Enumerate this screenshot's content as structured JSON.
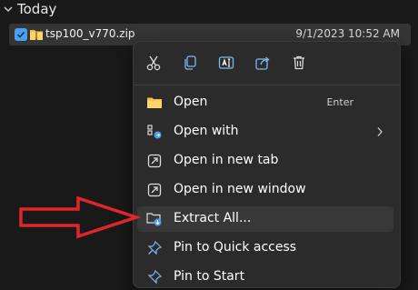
{
  "group": {
    "label": "Today",
    "icon": "chevron-down-icon"
  },
  "file": {
    "name": "tsp100_v770.zip",
    "date": "9/1/2023 10:52 AM",
    "checked": true,
    "icon": "zip-folder-icon"
  },
  "context_menu": {
    "toolbar": [
      {
        "name": "cut",
        "icon": "scissors-icon"
      },
      {
        "name": "copy",
        "icon": "copy-icon"
      },
      {
        "name": "rename",
        "icon": "rename-icon"
      },
      {
        "name": "share",
        "icon": "share-icon"
      },
      {
        "name": "delete",
        "icon": "trash-icon"
      }
    ],
    "items": [
      {
        "label": "Open",
        "shortcut": "Enter",
        "icon": "folder-icon"
      },
      {
        "label": "Open with",
        "icon": "open-with-icon",
        "submenu": true
      },
      {
        "label": "Open in new tab",
        "icon": "new-tab-icon"
      },
      {
        "label": "Open in new window",
        "icon": "new-window-icon"
      },
      {
        "label": "Extract All...",
        "icon": "extract-icon",
        "highlighted": true
      },
      {
        "label": "Pin to Quick access",
        "icon": "pin-icon"
      },
      {
        "label": "Pin to Start",
        "icon": "pin-start-icon"
      }
    ]
  },
  "annotation": {
    "type": "arrow",
    "color": "#e0262b",
    "points_to": "Extract All..."
  },
  "colors": {
    "background": "#191919",
    "menu_background": "#2b2b2b",
    "selection_row": "#353535",
    "accent": "#4aa0f0",
    "folder": "#f2c14e",
    "arrow": "#e0262b"
  }
}
